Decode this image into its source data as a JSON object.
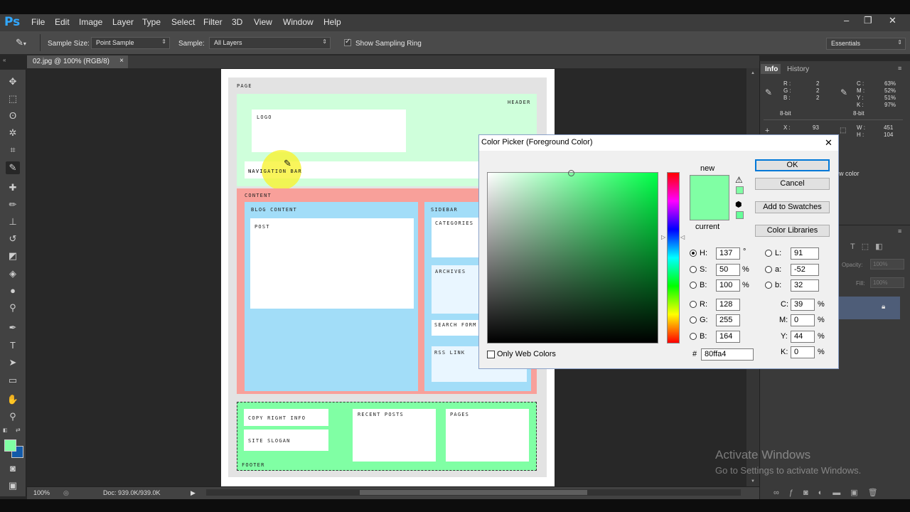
{
  "app": {
    "logo": "Ps",
    "window_controls": [
      "–",
      "❐",
      "✕"
    ]
  },
  "menu": [
    "File",
    "Edit",
    "Image",
    "Layer",
    "Type",
    "Select",
    "Filter",
    "3D",
    "View",
    "Window",
    "Help"
  ],
  "options": {
    "sample_size_label": "Sample Size:",
    "sample_size_value": "Point Sample",
    "sample_label": "Sample:",
    "sample_value": "All Layers",
    "show_ring_label": "Show Sampling Ring",
    "show_ring_checked": true,
    "workspace_value": "Essentials"
  },
  "document_tab": {
    "title": "02.jpg @ 100% (RGB/8)",
    "close": "×"
  },
  "wireframe": {
    "page": "PAGE",
    "header": "HEADER",
    "logo": "LOGO",
    "navigation_bar": "NAVIGATION BAR",
    "content": "CONTENT",
    "blog_content": "BLOG CONTENT",
    "post": "POST",
    "sidebar": "SIDEBAR",
    "categories": "CATEGORIES",
    "archives": "ARCHIVES",
    "search_form": "SEARCH FORM",
    "rss_link": "RSS LINK",
    "copyright": "COPY RIGHT INFO",
    "site_slogan": "SITE SLOGAN",
    "recent_posts": "RECENT POSTS",
    "pages": "PAGES",
    "footer": "FOOTER"
  },
  "status": {
    "zoom": "100%",
    "doc": "Doc: 939.0K/939.0K"
  },
  "info_panel": {
    "tabs": [
      "Info",
      "History"
    ],
    "rgb": {
      "R": "2",
      "G": "2",
      "B": "2"
    },
    "rgb_bit": "8-bit",
    "cmyk": {
      "C": "63%",
      "M": "52%",
      "Y": "51%",
      "K": "97%"
    },
    "cmyk_bit": "8-bit",
    "xy": {
      "X": "93",
      "Y": "157"
    },
    "wh": {
      "W": "451",
      "H": "104"
    },
    "partial_text": "w color"
  },
  "layers_panel": {
    "opacity_label": "Opacity:",
    "opacity_value": "100%",
    "fill_label": "Fill:",
    "fill_value": "100%"
  },
  "color_picker": {
    "title": "Color Picker (Foreground Color)",
    "close": "✕",
    "new_label": "new",
    "current_label": "current",
    "new_color": "#80ffa4",
    "current_color": "#80ffa4",
    "buttons": {
      "ok": "OK",
      "cancel": "Cancel",
      "add_swatches": "Add to Swatches",
      "color_libraries": "Color Libraries"
    },
    "only_web_colors": "Only Web Colors",
    "hsb": {
      "H": "137",
      "S": "50",
      "B": "100",
      "selected": "H"
    },
    "rgb": {
      "R": "128",
      "G": "255",
      "B": "164"
    },
    "lab": {
      "L": "91",
      "a": "-52",
      "b": "32"
    },
    "cmyk": {
      "C": "39",
      "M": "0",
      "Y": "44",
      "K": "0"
    },
    "hex_label": "#",
    "hex": "80ffa4",
    "units": {
      "degree": "°",
      "percent": "%"
    },
    "hue_fraction": 0.38
  },
  "watermark": {
    "line1": "Activate Windows",
    "line2": "Go to Settings to activate Windows."
  }
}
